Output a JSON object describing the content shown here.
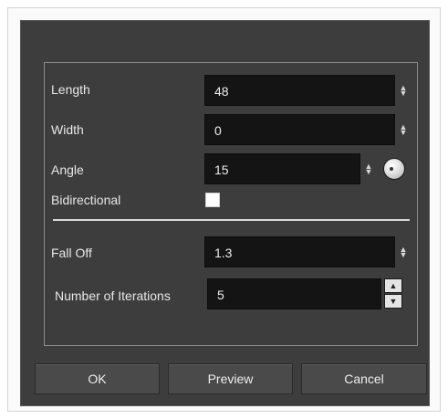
{
  "dialog": {
    "fields": {
      "length": {
        "label": "Length",
        "value": "48"
      },
      "width": {
        "label": "Width",
        "value": "0"
      },
      "angle": {
        "label": "Angle",
        "value": "15"
      },
      "bidirectional": {
        "label": "Bidirectional",
        "checked": false
      },
      "fall_off": {
        "label": "Fall Off",
        "value": "1.3"
      },
      "iterations": {
        "label": "Number of Iterations",
        "value": "5"
      }
    },
    "buttons": {
      "ok": "OK",
      "preview": "Preview",
      "cancel": "Cancel"
    }
  },
  "icons": {
    "spin": "up-down-arrows-icon",
    "dial": "angle-dial-icon",
    "stepper_up": "chevron-up-icon",
    "stepper_down": "chevron-down-icon"
  },
  "colors": {
    "dialog_bg": "#3d3d3d",
    "field_bg": "#141414",
    "text": "#e8e8e8"
  }
}
